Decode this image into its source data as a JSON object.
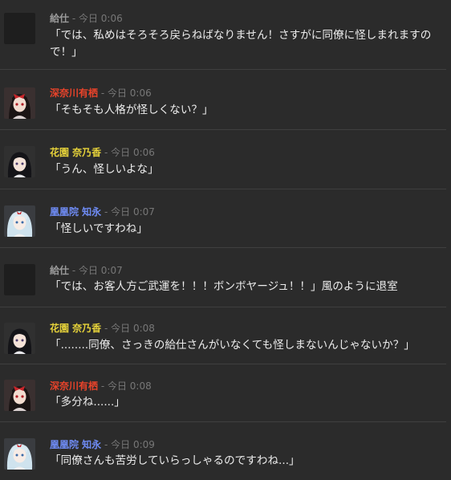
{
  "colors": {
    "background": "#2b2b2b",
    "divider": "#3f3f3f",
    "meta": "#777777",
    "text": "#ececec",
    "name_kyuji": "#9a9a9a",
    "name_fukanagawa": "#e8432a",
    "name_hanazono": "#e6d23a",
    "name_ouhouin": "#6f8cf5"
  },
  "messages": [
    {
      "name": "給仕",
      "meta": " - 今日 0:06",
      "name_color": "#9a9a9a",
      "avatar": "blank-avatar",
      "text": "「では、私めはそろそろ戻らねばなりません！さすがに同僚に怪しまれますので！」"
    },
    {
      "name": "深奈川有栖",
      "meta": " - 今日 0:06",
      "name_color": "#e8432a",
      "avatar": "red-ribbon-girl-avatar",
      "text": "「そもそも人格が怪しくない？」"
    },
    {
      "name": "花園 奈乃香",
      "meta": " - 今日 0:06",
      "name_color": "#e6d23a",
      "avatar": "black-hair-girl-avatar",
      "text": "「うん、怪しいよな」"
    },
    {
      "name": "凰凰院 知永",
      "meta": " - 今日 0:07",
      "name_color": "#6f8cf5",
      "avatar": "silver-hair-girl-avatar",
      "text": "「怪しいですわね」"
    },
    {
      "name": "給仕",
      "meta": " - 今日 0:07",
      "name_color": "#9a9a9a",
      "avatar": "blank-avatar",
      "text": "「では、お客人方ご武運を！！！ボンボヤージュ！！」風のように退室"
    },
    {
      "name": "花園 奈乃香",
      "meta": " - 今日 0:08",
      "name_color": "#e6d23a",
      "avatar": "black-hair-girl-avatar",
      "text": "「........同僚、さっきの給仕さんがいなくても怪しまないんじゃないか？」"
    },
    {
      "name": "深奈川有栖",
      "meta": " - 今日 0:08",
      "name_color": "#e8432a",
      "avatar": "red-ribbon-girl-avatar",
      "text": "「多分ね......」"
    },
    {
      "name": "凰凰院 知永",
      "meta": " - 今日 0:09",
      "name_color": "#6f8cf5",
      "avatar": "silver-hair-girl-avatar",
      "text": "「同僚さんも苦労していらっしゃるのですわね...」"
    }
  ]
}
